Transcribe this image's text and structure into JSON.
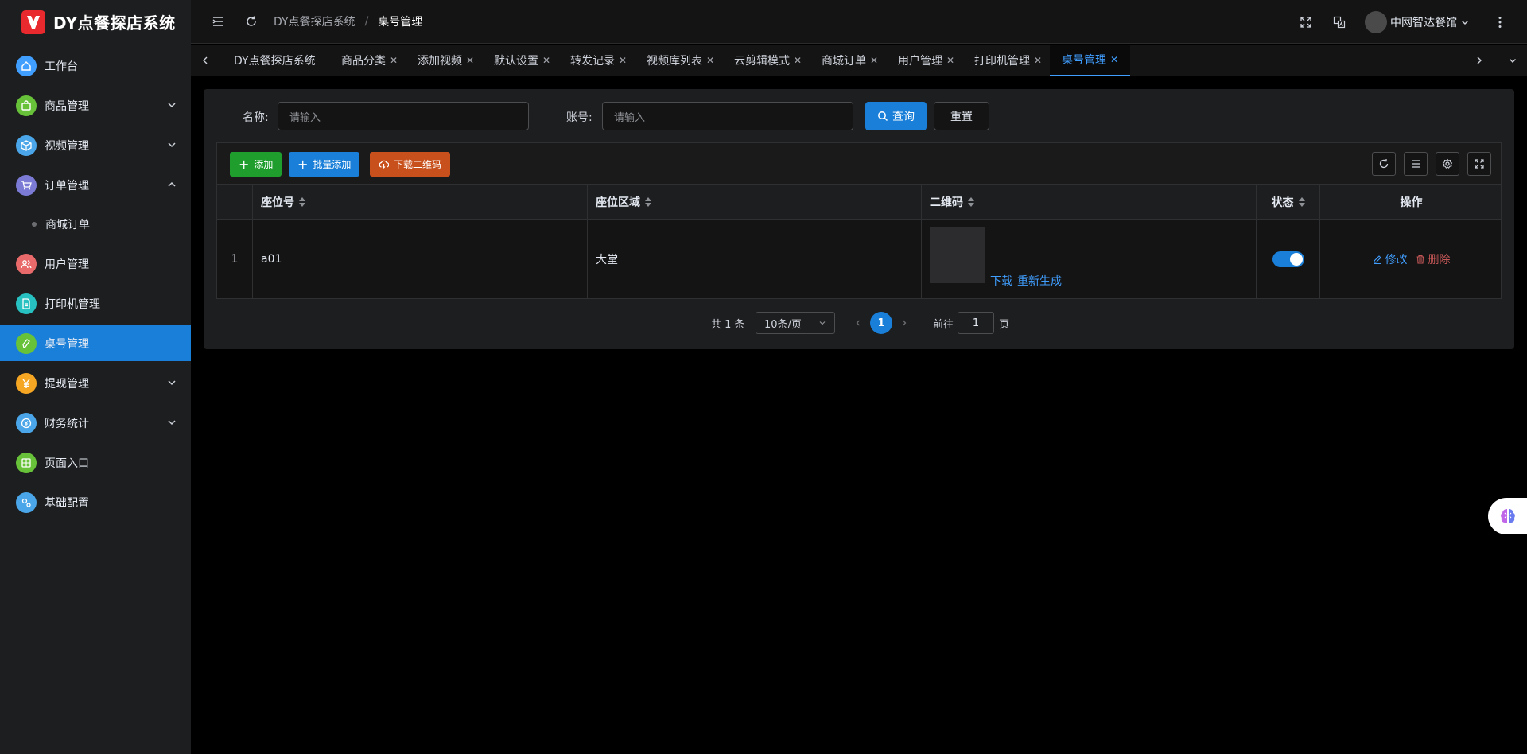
{
  "app": {
    "title": "DY点餐探店系统"
  },
  "sidebar": {
    "items": [
      {
        "label": "工作台",
        "icon": "home-icon",
        "color": "#409eff"
      },
      {
        "label": "商品管理",
        "icon": "bag-icon",
        "color": "#67c23a",
        "expandable": true
      },
      {
        "label": "视频管理",
        "icon": "box-icon",
        "color": "#4aa6e8",
        "expandable": true
      },
      {
        "label": "订单管理",
        "icon": "cart-icon",
        "color": "#7b7bd6",
        "expandable": true,
        "expanded": true
      },
      {
        "label": "商城订单",
        "sub": true
      },
      {
        "label": "用户管理",
        "icon": "users-icon",
        "color": "#e86a6a"
      },
      {
        "label": "打印机管理",
        "icon": "document-icon",
        "color": "#28c1c1"
      },
      {
        "label": "桌号管理",
        "icon": "pen-icon",
        "color": "#67c23a",
        "active": true
      },
      {
        "label": "提现管理",
        "icon": "yen-icon",
        "color": "#f5a623",
        "expandable": true
      },
      {
        "label": "财务统计",
        "icon": "coin-icon",
        "color": "#4aa6e8",
        "expandable": true
      },
      {
        "label": "页面入口",
        "icon": "grid-icon",
        "color": "#67c23a"
      },
      {
        "label": "基础配置",
        "icon": "gears-icon",
        "color": "#4aa6e8"
      }
    ]
  },
  "header": {
    "breadcrumb": [
      "DY点餐探店系统",
      "桌号管理"
    ],
    "user": "中网智达餐馆"
  },
  "tabs": [
    {
      "label": "DY点餐探店系统",
      "closable": false
    },
    {
      "label": "商品分类",
      "closable": true
    },
    {
      "label": "添加视频",
      "closable": true
    },
    {
      "label": "默认设置",
      "closable": true
    },
    {
      "label": "转发记录",
      "closable": true
    },
    {
      "label": "视频库列表",
      "closable": true
    },
    {
      "label": "云剪辑模式",
      "closable": true
    },
    {
      "label": "商城订单",
      "closable": true
    },
    {
      "label": "用户管理",
      "closable": true
    },
    {
      "label": "打印机管理",
      "closable": true
    },
    {
      "label": "桌号管理",
      "closable": true,
      "active": true
    }
  ],
  "search": {
    "name_label": "名称:",
    "name_placeholder": "请输入",
    "account_label": "账号:",
    "account_placeholder": "请输入",
    "query_label": "查询",
    "reset_label": "重置"
  },
  "toolbar": {
    "add_label": "添加",
    "batch_add_label": "批量添加",
    "download_qr_label": "下载二维码"
  },
  "table": {
    "columns": [
      "座位号",
      "座位区域",
      "二维码",
      "状态",
      "操作"
    ],
    "rows": [
      {
        "index": "1",
        "seat": "a01",
        "area": "大堂",
        "qr_download": "下载",
        "qr_regenerate": "重新生成",
        "status_on": true,
        "edit": "修改",
        "delete": "删除"
      }
    ]
  },
  "pagination": {
    "total": "共 1 条",
    "page_size": "10条/页",
    "current_page": "1",
    "goto_label": "前往",
    "goto_value": "1",
    "page_suffix": "页"
  },
  "colors": {
    "accent": "#1a7fd8",
    "success": "#1f9e2e",
    "warning": "#c8501c",
    "danger": "#c45656",
    "link": "#409eff"
  }
}
